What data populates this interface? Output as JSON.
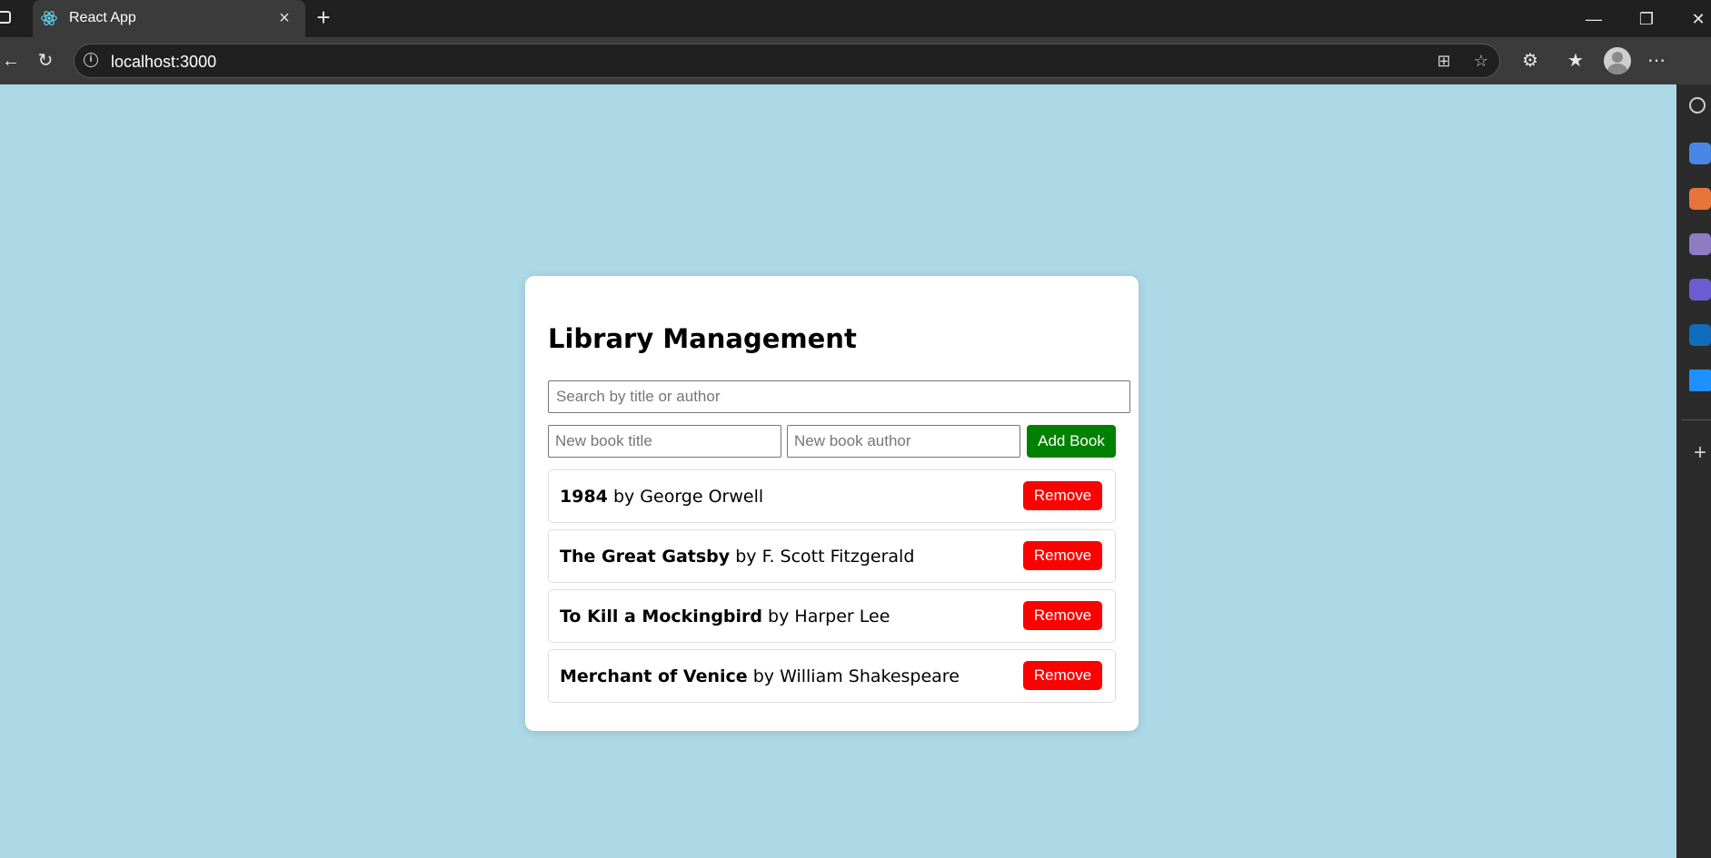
{
  "browser": {
    "tab_title": "React App",
    "tab_close": "×",
    "new_tab": "+",
    "url": "localhost:3000",
    "window": {
      "minimize": "—",
      "restore": "❐",
      "close": "✕"
    }
  },
  "app": {
    "heading": "Library Management",
    "search_placeholder": "Search by title or author",
    "new_title_placeholder": "New book title",
    "new_author_placeholder": "New book author",
    "add_label": "Add Book",
    "remove_label": "Remove",
    "by_word": "by",
    "books": [
      {
        "title": "1984",
        "author": "George Orwell"
      },
      {
        "title": "The Great Gatsby",
        "author": "F. Scott Fitzgerald"
      },
      {
        "title": "To Kill a Mockingbird",
        "author": "Harper Lee"
      },
      {
        "title": "Merchant of Venice",
        "author": "William Shakespeare"
      }
    ]
  },
  "colors": {
    "page_background": "#add8e6",
    "add_button": "#008000",
    "remove_button": "#ff0000"
  }
}
